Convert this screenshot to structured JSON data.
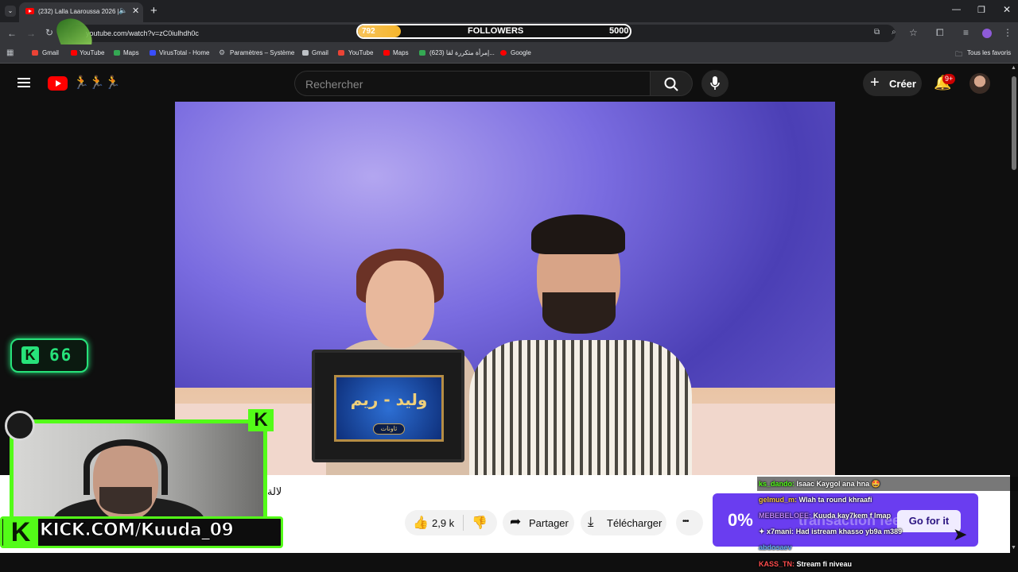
{
  "browser": {
    "tab_title": "(232) Lalla Laaroussa 2026 |",
    "url": "youtube.com/watch?v=zC0iulhdh0c",
    "bookmarks": [
      {
        "label": "Gmail",
        "color": "#ea4335"
      },
      {
        "label": "YouTube",
        "color": "#ff0000"
      },
      {
        "label": "Maps",
        "color": "#34a853"
      },
      {
        "label": "VirusTotal - Home",
        "color": "#394eff"
      },
      {
        "label": "Paramètres – Système",
        "color": "#bdc1c6"
      },
      {
        "label": "Gmail",
        "color": "#ea4335"
      },
      {
        "label": "YouTube",
        "color": "#ff0000"
      },
      {
        "label": "Maps",
        "color": "#34a853"
      },
      {
        "label": "(623) إمرأة متكررة لقا...",
        "color": "#ff0000"
      },
      {
        "label": "Google",
        "color": "#4285f4"
      }
    ],
    "all_bookmarks": "Tous les favoris"
  },
  "followers": {
    "label": "FOLLOWERS",
    "current": "792",
    "goal": "5000",
    "progress_fraction": 0.158,
    "fill_color": "#f5b52c"
  },
  "youtube": {
    "search_placeholder": "Rechercher",
    "create_label": "Créer",
    "notification_badge": "9+",
    "video": {
      "monitor_text": "وليد - ريم",
      "monitor_sub": "ثاونات"
    },
    "title_fragment": "لالة",
    "actions": {
      "likes": "2,9 k",
      "share": "Partager",
      "download": "Télécharger",
      "more": "•••"
    }
  },
  "stream": {
    "viewer_count": "66",
    "kick_url": "KICK.COM/Kuuda_09",
    "accent_color": "#53fc18",
    "ad": {
      "percent": "0%",
      "fees_text": "transaction fees",
      "button": "Go for it"
    },
    "chat": [
      {
        "user": "ks_dando:",
        "msg": "Isaac Kaygol ana hna 🤩",
        "color": "#53fc18"
      },
      {
        "user": "gelmud_m:",
        "msg": "Wlah ta round khraafi",
        "color": "#f5c542"
      },
      {
        "user": "MEBEBELOEE:",
        "msg": "Kuuda kay7kem f lmap",
        "color": "#c084fc"
      },
      {
        "user": "✦ x7mani:",
        "msg": "Had istream khasso yb9a m389",
        "color": "#ffffff"
      },
      {
        "user": "abdosaev",
        "msg": "",
        "color": "#60a5fa"
      },
      {
        "user": "KASS_TN:",
        "msg": "Stream fi niveau",
        "color": "#ff4d4d"
      }
    ]
  }
}
